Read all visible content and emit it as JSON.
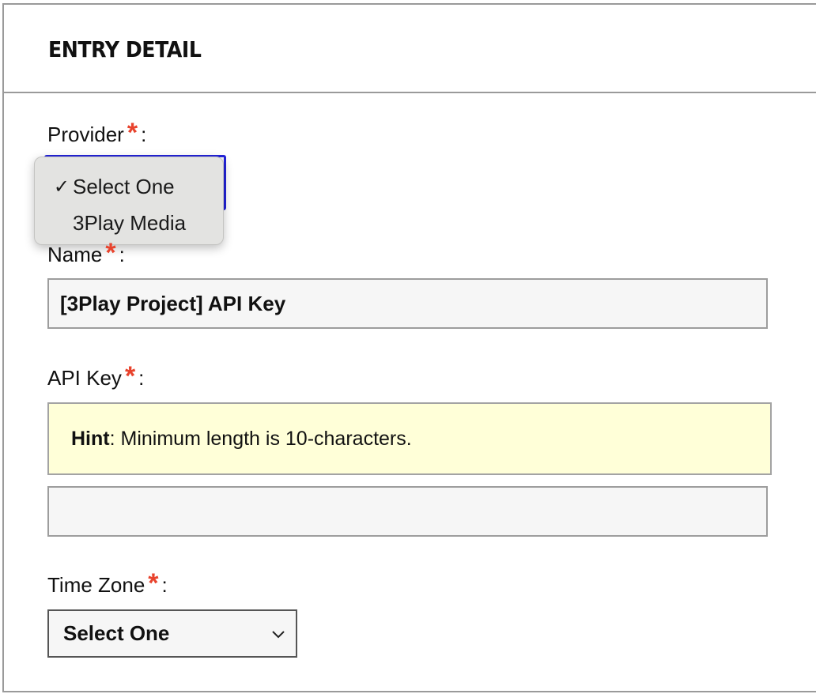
{
  "panel": {
    "title": "ENTRY DETAIL"
  },
  "provider": {
    "label": "Provider",
    "required_mark": "*",
    "colon": ":",
    "options": [
      {
        "label": "Select One",
        "checked": true,
        "check_glyph": "✓"
      },
      {
        "label": "3Play Media",
        "checked": false
      }
    ]
  },
  "name": {
    "label": "Name",
    "required_mark": "*",
    "colon": ":",
    "value": "[3Play Project] API Key"
  },
  "api_key": {
    "label": "API Key",
    "required_mark": "*",
    "colon": ":",
    "hint_title": "Hint",
    "hint_text": ": Minimum length is 10-characters.",
    "value": ""
  },
  "time_zone": {
    "label": "Time Zone",
    "required_mark": "*",
    "colon": ":",
    "selected": "Select One",
    "icon": "chevron-down-icon"
  },
  "colors": {
    "required": "#e8432d",
    "focus_border": "#2323d9",
    "hint_background": "#ffffd8"
  }
}
